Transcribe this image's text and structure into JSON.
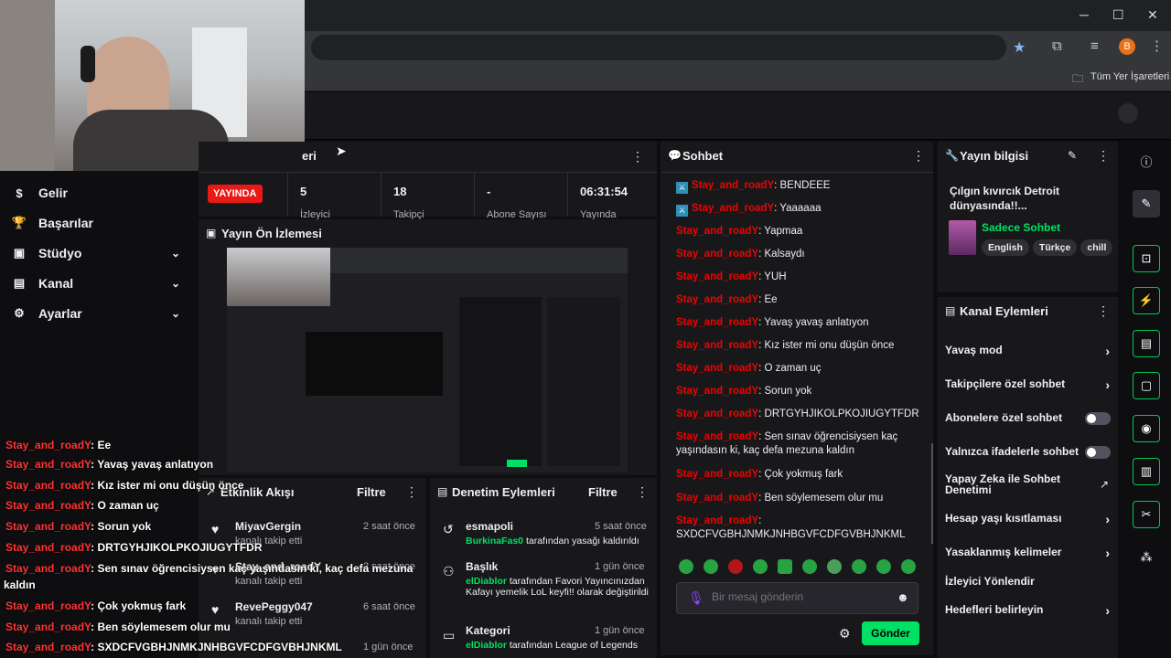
{
  "browser": {
    "bookmarks_label": "Tüm Yer İşaretleri",
    "profile_initial": "B",
    "minimize": "─",
    "maximize": "☐",
    "close": "✕"
  },
  "sidebar": {
    "items": [
      {
        "icon": "$",
        "label": "Gelir"
      },
      {
        "icon": "🏆",
        "label": "Başarılar"
      },
      {
        "icon": "▣",
        "label": "Stüdyo",
        "chevron": "⌄"
      },
      {
        "icon": "▤",
        "label": "Kanal",
        "chevron": "⌄"
      },
      {
        "icon": "⚙",
        "label": "Ayarlar",
        "chevron": "⌄"
      }
    ]
  },
  "overlay_chat": [
    {
      "user": "Stay_and_roadY",
      "text": ": Ee"
    },
    {
      "user": "Stay_and_roadY",
      "text": ": Yavaş yavaş anlatıyon"
    },
    {
      "user": "Stay_and_roadY",
      "text": ": Kız ister mi onu düşün önce"
    },
    {
      "user": "Stay_and_roadY",
      "text": ": O zaman uç"
    },
    {
      "user": "Stay_and_roadY",
      "text": ": Sorun yok"
    },
    {
      "user": "Stay_and_roadY",
      "text": ": DRTGYHJIKOLPKOJIUGYTFDR"
    },
    {
      "user": "Stay_and_roadY",
      "text": ": Sen sınav öğrencisiysen kaç yaşındasın ki, kaç defa mezuna"
    },
    {
      "user": "",
      "text": "kaldın"
    },
    {
      "user": "Stay_and_roadY",
      "text": ": Çok yokmuş fark"
    },
    {
      "user": "Stay_and_roadY",
      "text": ": Ben söylemesem olur mu"
    },
    {
      "user": "Stay_and_roadY",
      "text": ": SXDCFVGBHJNMKJNHBGVFCDFGVBHJNKML"
    }
  ],
  "stats": {
    "title_fragment": "eri",
    "live_badge": "YAYINDA",
    "items": [
      {
        "value": "5",
        "label": "İzleyici"
      },
      {
        "value": "18",
        "label": "Takipçi"
      },
      {
        "value": "-",
        "label": "Abone Sayısı"
      },
      {
        "value": "06:31:54",
        "label": "Yayında"
      }
    ]
  },
  "preview": {
    "title": "Yayın Ön İzlemesi"
  },
  "activity": {
    "title": "Etkinlik Akışı",
    "filter": "Filtre",
    "items": [
      {
        "name": "MiyavGergin",
        "sub": "kanalı takip etti",
        "time": "2 saat önce"
      },
      {
        "name": "Stay_and_roadY",
        "sub": "kanalı takip etti",
        "time": "2 saat önce"
      },
      {
        "name": "RevePeggy047",
        "sub": "kanalı takip etti",
        "time": "6 saat önce"
      },
      {
        "name": "",
        "sub": "",
        "time": "1 gün önce"
      }
    ]
  },
  "mod_actions": {
    "title": "Denetim Eylemleri",
    "filter": "Filtre",
    "items": [
      {
        "title": "esmapoli",
        "actor": "BurkinaFas0",
        "desc": " tarafından yasağı kaldırıldı",
        "time": "5 saat önce"
      },
      {
        "title": "Başlık",
        "actor": "elDiablor",
        "desc": " tarafından Favori Yayıncınızdan Kafayı yemelik LoL keyfi!! olarak değiştirildi",
        "time": "1 gün önce"
      },
      {
        "title": "Kategori",
        "actor": "elDiablor",
        "desc": " tarafından League of Legends",
        "time": "1 gün önce"
      }
    ]
  },
  "chat": {
    "title": "Sohbet",
    "placeholder": "Bir mesaj gönderin",
    "send": "Gönder",
    "messages": [
      {
        "user": "Stay_and_roadY",
        "text": ": BENDEEE",
        "badge": true
      },
      {
        "user": "Stay_and_roadY",
        "text": ": Yaaaaaa",
        "badge": true
      },
      {
        "user": "Stay_and_roadY",
        "text": ": Yapmaa"
      },
      {
        "user": "Stay_and_roadY",
        "text": ": Kalsaydı"
      },
      {
        "user": "Stay_and_roadY",
        "text": ": YUH"
      },
      {
        "user": "Stay_and_roadY",
        "text": ": Ee"
      },
      {
        "user": "Stay_and_roadY",
        "text": ": Yavaş yavaş anlatıyon"
      },
      {
        "user": "Stay_and_roadY",
        "text": ": Kız ister mi onu düşün önce"
      },
      {
        "user": "Stay_and_roadY",
        "text": ": O zaman uç"
      },
      {
        "user": "Stay_and_roadY",
        "text": ": Sorun yok"
      },
      {
        "user": "Stay_and_roadY",
        "text": ": DRTGYHJIKOLPKOJIUGYTFDR"
      },
      {
        "user": "Stay_and_roadY",
        "text": ": Sen sınav öğrencisiysen kaç yaşındasın ki, kaç defa mezuna kaldın"
      },
      {
        "user": "Stay_and_roadY",
        "text": ": Çok yokmuş fark"
      },
      {
        "user": "Stay_and_roadY",
        "text": ": Ben söylemesem olur mu"
      },
      {
        "user": "Stay_and_roadY",
        "text": ": SXDCFVGBHJNMKJNHBGVFCDFGVBHJNKML"
      }
    ]
  },
  "stream_info": {
    "title": "Yayın bilgisi",
    "stream_title": "Çılgın kıvırcık Detroit dünyasında!!...",
    "category": "Sadece Sohbet",
    "tags": [
      "English",
      "Türkçe",
      "chill"
    ]
  },
  "channel_actions": {
    "title": "Kanal Eylemleri",
    "items": [
      {
        "label": "Yavaş mod",
        "control": "arrow"
      },
      {
        "label": "Takipçilere özel sohbet",
        "control": "arrow"
      },
      {
        "label": "Abonelere özel sohbet",
        "control": "toggle"
      },
      {
        "label": "Yalnızca ifadelerle sohbet",
        "control": "toggle"
      },
      {
        "label": "Yapay Zeka ile Sohbet Denetimi",
        "control": "external"
      },
      {
        "label": "Hesap yaşı kısıtlaması",
        "control": "arrow"
      },
      {
        "label": "Yasaklanmış kelimeler",
        "control": "arrow"
      },
      {
        "label": "İzleyici Yönlendir",
        "control": "none"
      },
      {
        "label": "Hedefleri belirleyin",
        "control": "arrow"
      }
    ]
  },
  "colors": {
    "accent_green": "#00e064",
    "live_red": "#e91916",
    "chat_user_red": "#eb0400"
  }
}
